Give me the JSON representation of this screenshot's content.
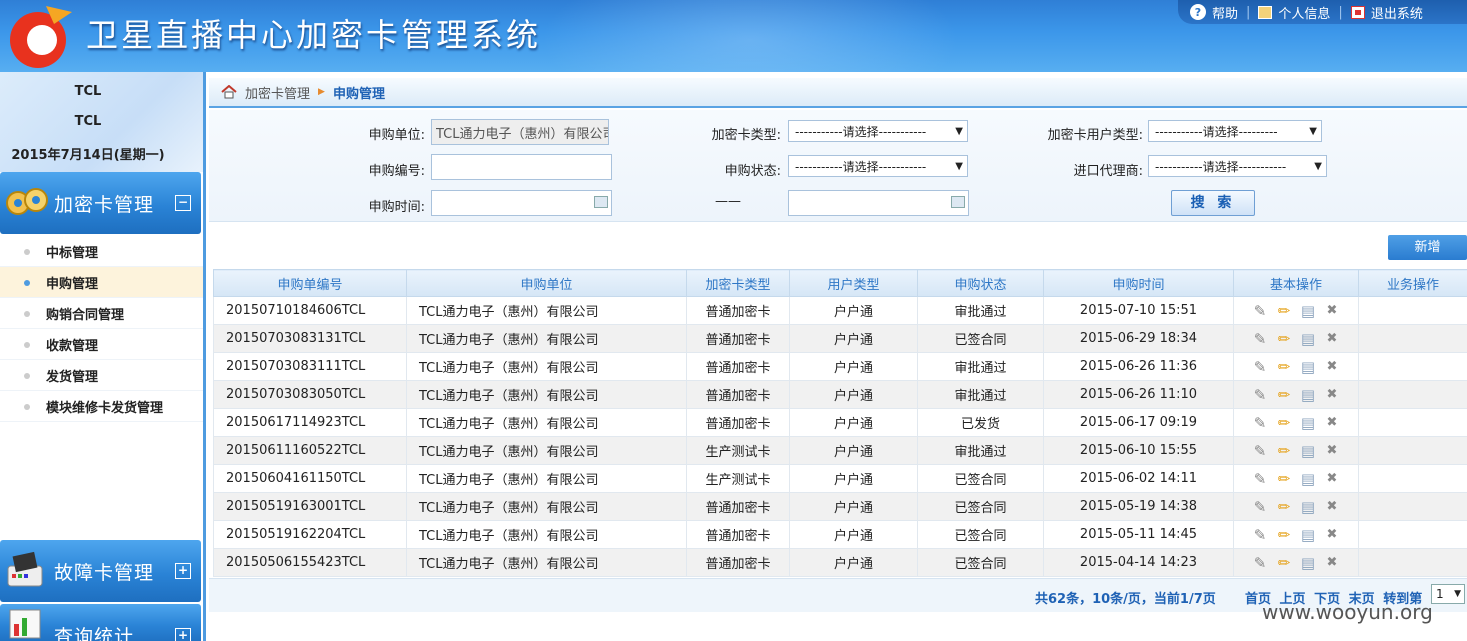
{
  "header": {
    "title": "卫星直播中心加密卡管理系统",
    "links": {
      "help": "帮助",
      "profile": "个人信息",
      "logout": "退出系统"
    }
  },
  "user": {
    "line1": "TCL",
    "line2": "TCL",
    "date": "2015年7月14日(星期一)"
  },
  "sidebar": {
    "menus": [
      {
        "label": "加密卡管理",
        "toggle": "−"
      },
      {
        "label": "故障卡管理",
        "toggle": "+"
      },
      {
        "label": "查询统计",
        "toggle": "+"
      }
    ],
    "items": [
      {
        "label": "中标管理"
      },
      {
        "label": "申购管理"
      },
      {
        "label": "购销合同管理"
      },
      {
        "label": "收款管理"
      },
      {
        "label": "发货管理"
      },
      {
        "label": "模块维修卡发货管理"
      }
    ]
  },
  "breadcrumb": {
    "parent": "加密卡管理",
    "current": "申购管理"
  },
  "search": {
    "unit_label": "申购单位:",
    "unit_value": "TCL通力电子（惠州）有限公司",
    "card_type_label": "加密卡类型:",
    "card_type_value": "-----------请选择-----------",
    "user_type_label": "加密卡用户类型:",
    "user_type_value": "-----------请选择---------",
    "number_label": "申购编号:",
    "number_value": "",
    "status_label": "申购状态:",
    "status_value": "-----------请选择-----------",
    "agent_label": "进口代理商:",
    "agent_value": "-----------请选择-----------",
    "time_label": "申购时间:",
    "time_sep": "——",
    "search_button": "搜 索"
  },
  "new_button": "新增",
  "table": {
    "headers": [
      "申购单编号",
      "申购单位",
      "加密卡类型",
      "用户类型",
      "申购状态",
      "申购时间",
      "基本操作",
      "业务操作"
    ],
    "rows": [
      [
        "20150710184606TCL",
        "TCL通力电子（惠州）有限公司",
        "普通加密卡",
        "户户通",
        "审批通过",
        "2015-07-10 15:51"
      ],
      [
        "20150703083131TCL",
        "TCL通力电子（惠州）有限公司",
        "普通加密卡",
        "户户通",
        "已签合同",
        "2015-06-29 18:34"
      ],
      [
        "20150703083111TCL",
        "TCL通力电子（惠州）有限公司",
        "普通加密卡",
        "户户通",
        "审批通过",
        "2015-06-26 11:36"
      ],
      [
        "20150703083050TCL",
        "TCL通力电子（惠州）有限公司",
        "普通加密卡",
        "户户通",
        "审批通过",
        "2015-06-26 11:10"
      ],
      [
        "20150617114923TCL",
        "TCL通力电子（惠州）有限公司",
        "普通加密卡",
        "户户通",
        "已发货",
        "2015-06-17 09:19"
      ],
      [
        "20150611160522TCL",
        "TCL通力电子（惠州）有限公司",
        "生产测试卡",
        "户户通",
        "审批通过",
        "2015-06-10 15:55"
      ],
      [
        "20150604161150TCL",
        "TCL通力电子（惠州）有限公司",
        "生产测试卡",
        "户户通",
        "已签合同",
        "2015-06-02 14:11"
      ],
      [
        "20150519163001TCL",
        "TCL通力电子（惠州）有限公司",
        "普通加密卡",
        "户户通",
        "已签合同",
        "2015-05-19 14:38"
      ],
      [
        "20150519162204TCL",
        "TCL通力电子（惠州）有限公司",
        "普通加密卡",
        "户户通",
        "已签合同",
        "2015-05-11 14:45"
      ],
      [
        "20150506155423TCL",
        "TCL通力电子（惠州）有限公司",
        "普通加密卡",
        "户户通",
        "已签合同",
        "2015-04-14 14:23"
      ]
    ]
  },
  "pager": {
    "info": "共62条，10条/页，当前1/7页",
    "first": "首页",
    "prev": "上页",
    "next": "下页",
    "last": "末页",
    "goto": "转到第",
    "page": "1"
  },
  "watermark": "www.wooyun.org",
  "colors": {
    "accent": "#2e77c6",
    "header": "#3c97ea",
    "active_item": "#fdf3dc"
  }
}
